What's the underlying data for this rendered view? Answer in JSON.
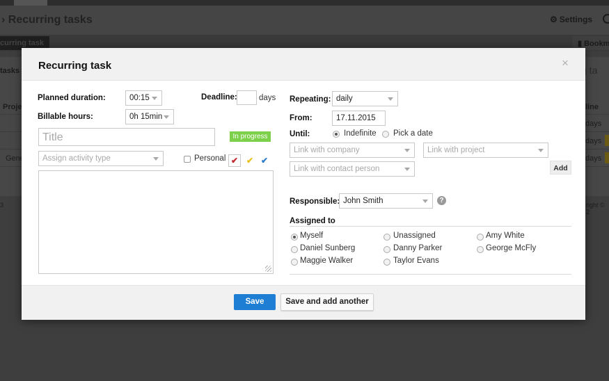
{
  "background": {
    "page_title": "› Recurring tasks",
    "settings_label": "Settings",
    "chip_label": "curring task",
    "bookmark_label": "Bookm",
    "tasks_label": "tasks",
    "search_fragment": "g ta",
    "proj_header": "Proje",
    "line_header": "line",
    "gen_cell": "Gene",
    "days_cells": [
      "days",
      "days",
      "days"
    ],
    "footer_left": "3",
    "footer_right": "right © 2"
  },
  "modal": {
    "title": "Recurring task",
    "close_icon": "×",
    "left": {
      "planned_duration_label": "Planned duration:",
      "planned_duration_value": "00:15",
      "deadline_label": "Deadline:",
      "deadline_value": "",
      "deadline_unit": "days",
      "billable_label": "Billable hours:",
      "billable_value": "0h 15min",
      "title_placeholder": "Title",
      "status_badge": "In progress",
      "activity_placeholder": "Assign activity type",
      "personal_label": "Personal",
      "priority_marks": [
        "✔",
        "✔",
        "✔"
      ],
      "description_value": ""
    },
    "right": {
      "repeating_label": "Repeating:",
      "repeating_value": "daily",
      "from_label": "From:",
      "from_value": "17.11.2015",
      "until_label": "Until:",
      "until_options": [
        "Indefinite",
        "Pick a date"
      ],
      "company_placeholder": "Link with company",
      "project_placeholder": "Link with project",
      "contact_placeholder": "Link with contact person",
      "add_label": "Add",
      "responsible_label": "Responsible:",
      "responsible_value": "John Smith",
      "help_icon": "?",
      "assigned_label": "Assigned to",
      "assignees": [
        "Myself",
        "Unassigned",
        "Amy White",
        "Daniel Sunberg",
        "Danny Parker",
        "George McFly",
        "Maggie Walker",
        "Taylor Evans"
      ]
    },
    "footer": {
      "save_label": "Save",
      "save_another_label": "Save and add another"
    }
  },
  "colors": {
    "primary": "#1d7ed4",
    "status_green": "#7cd04a",
    "priority_red": "#c0262a",
    "priority_yellow": "#e8c21a",
    "priority_blue": "#2d7cc9"
  }
}
